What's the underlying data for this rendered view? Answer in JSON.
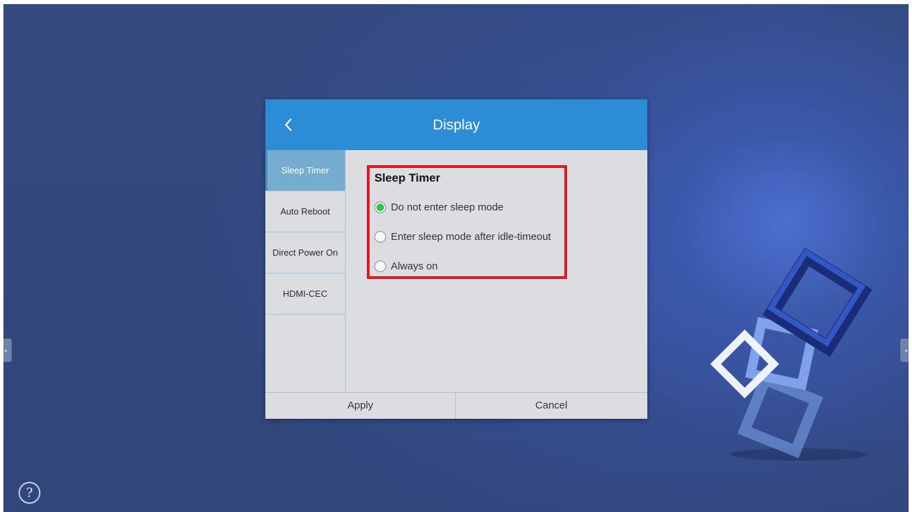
{
  "dialog": {
    "title": "Display",
    "back_icon": "chevron-left-icon",
    "menu": [
      {
        "label": "Sleep Timer",
        "active": true
      },
      {
        "label": "Auto Reboot",
        "active": false
      },
      {
        "label": "Direct Power On",
        "active": false
      },
      {
        "label": "HDMI-CEC",
        "active": false
      }
    ],
    "section": {
      "title": "Sleep Timer",
      "options": [
        {
          "label": "Do not enter sleep mode",
          "selected": true
        },
        {
          "label": "Enter sleep mode after idle-timeout",
          "selected": false
        },
        {
          "label": "Always on",
          "selected": false
        }
      ]
    },
    "footer": {
      "apply_label": "Apply",
      "cancel_label": "Cancel"
    }
  },
  "screen": {
    "help_label": "?",
    "help_icon": "help-icon",
    "left_tab_icon": "arrow-right-icon",
    "right_tab_icon": "arrow-left-icon",
    "left_tab_glyph": "▸",
    "right_tab_glyph": "◂"
  },
  "colors": {
    "header": "#2c8cd6",
    "active_menu": "#76acd0",
    "highlight_border": "#e8141d",
    "radio_selected": "#28c84a",
    "background": "#344a80"
  }
}
